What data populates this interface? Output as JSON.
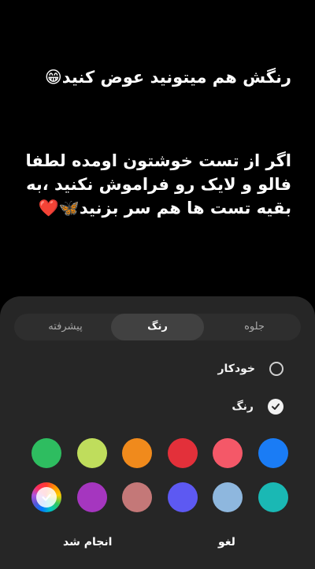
{
  "message": {
    "line1": "رنگش هم میتونید عوض کنید😁",
    "line2": "اگر از تست خوشتون اومده لطفا",
    "line3": "فالو و لایک رو فراموش نکنید ،به",
    "line4": "بقیه تست ها هم سر بزنید🦋❤️"
  },
  "tabs": {
    "left": "پیشرفته",
    "middle": "رنگ",
    "right": "جلوه"
  },
  "options": {
    "auto_label": "خودکار",
    "color_label": "رنگ",
    "selected": "color"
  },
  "colors": {
    "row1": [
      "#2ebd60",
      "#bfdd5c",
      "#f08a1c",
      "#e3303a",
      "#f45868",
      "#1a7cf5"
    ],
    "row2": [
      "picker",
      "#a536bf",
      "#c47878",
      "#5d59f2",
      "#8eb7de",
      "#1ab8b4"
    ],
    "picker_icon": "color-picker-icon",
    "selected_mark": "check-icon"
  },
  "buttons": {
    "done": "انجام شد",
    "cancel": "لغو"
  }
}
